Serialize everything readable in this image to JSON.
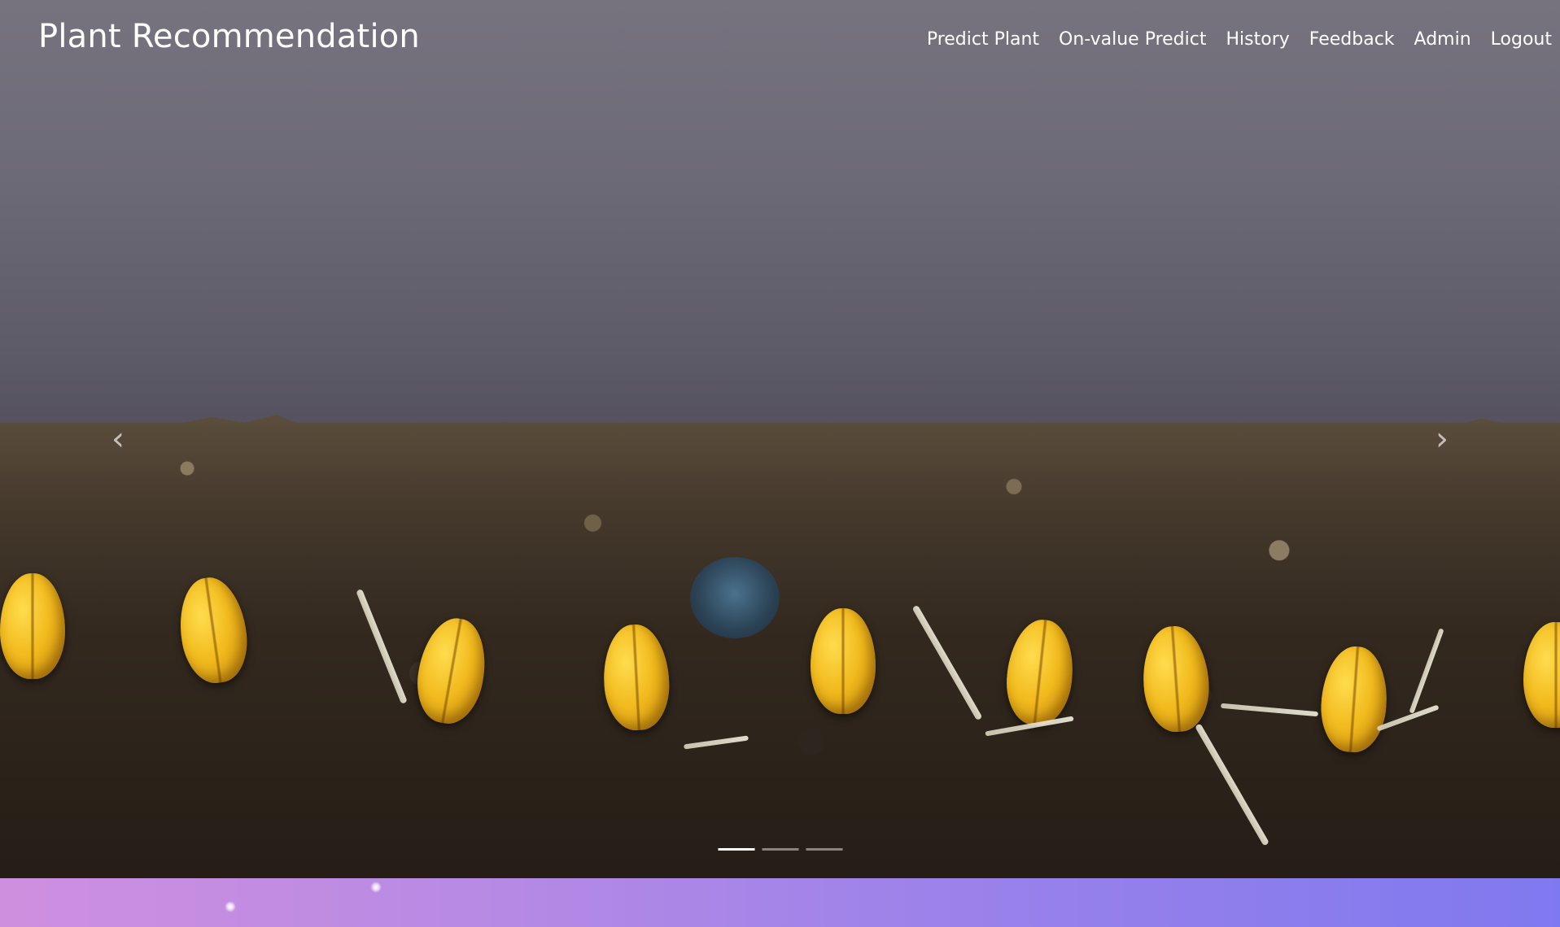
{
  "navbar": {
    "brand": "Plant Recommendation",
    "links": [
      {
        "label": "Predict Plant"
      },
      {
        "label": "On-value Predict"
      },
      {
        "label": "History"
      },
      {
        "label": "Feedback"
      },
      {
        "label": "Admin"
      },
      {
        "label": "Logout"
      }
    ]
  },
  "carousel": {
    "prev_icon": "chevron-left-icon",
    "next_icon": "chevron-right-icon",
    "prev_glyph": "‹",
    "next_glyph": "›",
    "slide_count": 3,
    "active_slide": 1,
    "image_description": "time-lapse of wheat seeds sprouting in soil"
  },
  "colors": {
    "nav_text": "#ffffff",
    "strip_start": "#cf8fdf",
    "strip_end": "#7f79ef"
  }
}
